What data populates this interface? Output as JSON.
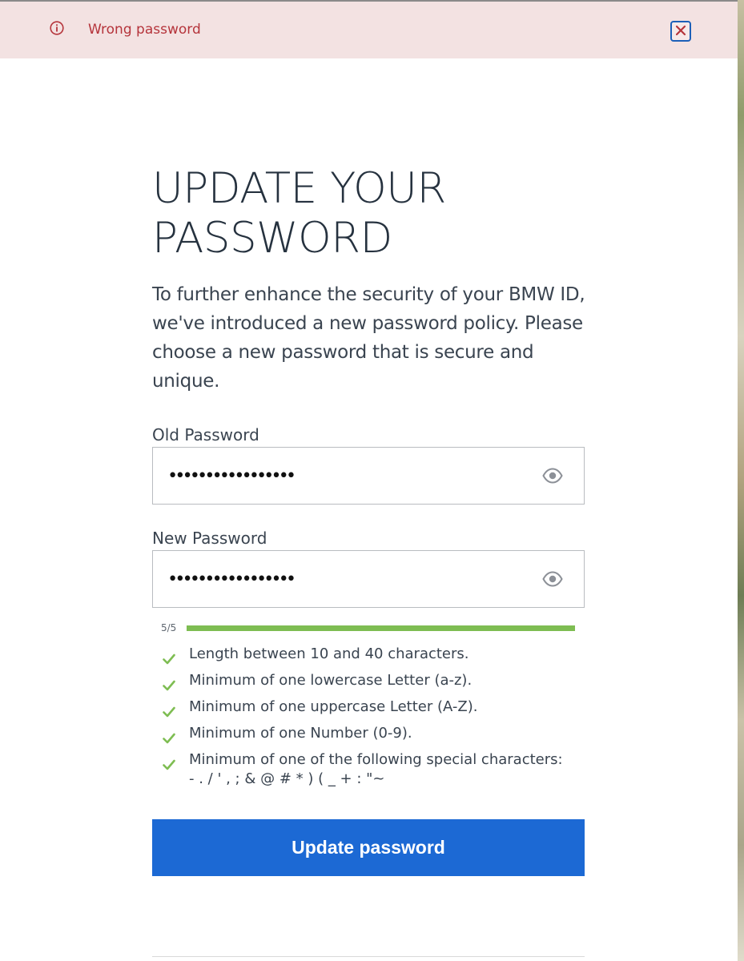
{
  "alert": {
    "icon": "info-circle-icon",
    "message": "Wrong password",
    "close_icon": "close-icon",
    "color": "#b5343b",
    "background": "#f3e2e2"
  },
  "heading": {
    "line1": "UPDATE YOUR",
    "line2": "PASSWORD"
  },
  "intro_text": "To further enhance the security of your BMW ID, we've introduced a new password policy. Please choose a new password that is secure and unique.",
  "form": {
    "old_password": {
      "label": "Old Password",
      "value": "•••••••••••••••••",
      "toggle_icon": "eye-icon"
    },
    "new_password": {
      "label": "New Password",
      "value": "•••••••••••••••••",
      "toggle_icon": "eye-icon"
    },
    "strength": {
      "label": "5/5",
      "score": 5,
      "max": 5,
      "color": "#7ebd52"
    },
    "rules": [
      {
        "text": "Length between 10 and 40 characters.",
        "met": true
      },
      {
        "text": "Minimum of one lowercase Letter (a-z).",
        "met": true
      },
      {
        "text": "Minimum of one uppercase Letter (A-Z).",
        "met": true
      },
      {
        "text": "Minimum of one Number (0-9).",
        "met": true
      },
      {
        "text": "Minimum of one of the following special characters:",
        "sub": "- . / ' , ; & @ # * ) ( _ + : \"~",
        "met": true
      }
    ],
    "submit_label": "Update password",
    "submit_color": "#1c69d4"
  }
}
